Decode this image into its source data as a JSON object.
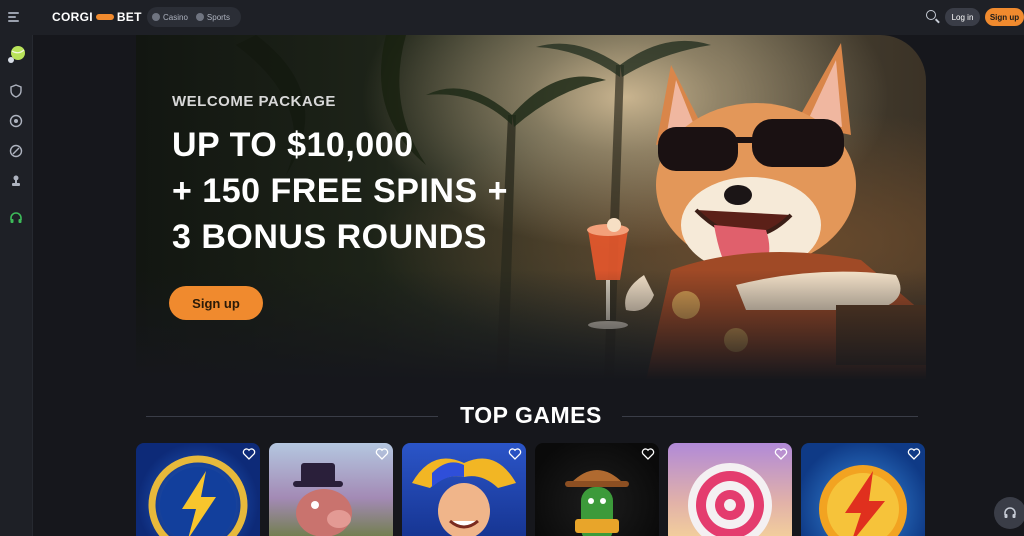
{
  "header": {
    "logo_left": "CORGI",
    "logo_right": "BET",
    "switcher": {
      "casino": "Casino",
      "sports": "Sports"
    },
    "login_label": "Log in",
    "signup_label": "Sign up"
  },
  "sidebar": {
    "items": [
      "tennis-ball-icon",
      "shield-icon",
      "target-icon",
      "compass-icon",
      "pawn-icon",
      "headset-icon"
    ]
  },
  "hero": {
    "kicker": "WELCOME PACKAGE",
    "lines": [
      "UP TO $10,000",
      "+ 150 FREE SPINS +",
      "3 BONUS ROUNDS"
    ],
    "cta_label": "Sign up"
  },
  "top_games": {
    "title": "TOP GAMES",
    "cards": [
      "lightning-coin",
      "pig-tophat",
      "jester",
      "cactus-cowboy",
      "candy-swirl",
      "fire-lightning"
    ]
  },
  "colors": {
    "accent": "#f08a2e",
    "background": "#16171c",
    "panel": "#1e2026"
  }
}
